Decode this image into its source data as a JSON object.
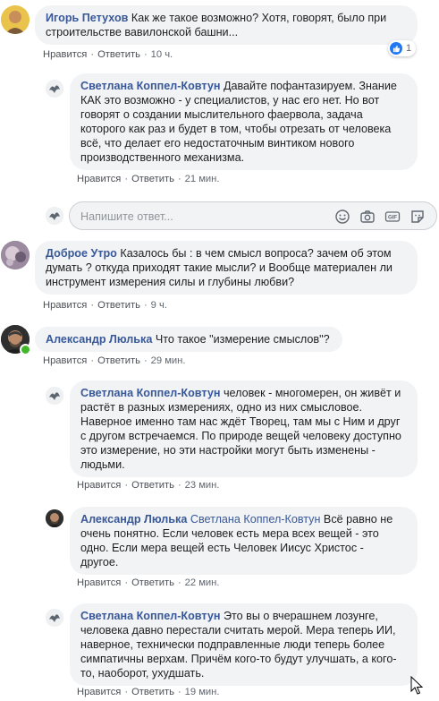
{
  "comments": [
    {
      "author": "Игорь Петухов",
      "text_lines": [
        "Как же такое возможно? Хотя, говорят, было при",
        "строительстве вавилонской башни..."
      ],
      "like": "Нравится",
      "reply": "Ответить",
      "time": "10 ч.",
      "reaction_count": "1"
    },
    {
      "author": "Светлана Коппел-Ковтун",
      "text_lines": [
        "Давайте пофантазируем. Знание",
        "КАК это возможно - у специалистов, у нас его нет. Но вот",
        "говорят о создании мыслительного фаервола, задача",
        "которого как раз и будет в том, чтобы отрезать от человека",
        "всё, что делает его недостаточным винтиком нового",
        "производственного механизма."
      ],
      "like": "Нравится",
      "reply": "Ответить",
      "time": "21 мин."
    },
    {
      "author": "Доброе Утро",
      "text_lines": [
        "Казалось бы : в чем смысл вопроса? зачем об этом",
        "думать ? откуда приходят такие мысли? и Вообще материален ли",
        "инструмент измерения силы и глубины любви?"
      ],
      "like": "Нравится",
      "reply": "Ответить",
      "time": "9 ч."
    },
    {
      "author": "Александр Люлька",
      "text_lines": [
        "Что такое \"измерение смыслов\"?"
      ],
      "like": "Нравится",
      "reply": "Ответить",
      "time": "29 мин."
    },
    {
      "author": "Светлана Коппел-Ковтун",
      "text_lines": [
        "человек - многомерен, он живёт и",
        "растёт в разных измерениях, одно из них смысловое.",
        "Наверное именно там нас ждёт Творец, там мы с Ним и друг",
        "с другом встречаемся. По природе вещей человеку доступно",
        "это измерение, но эти настройки могут быть изменены -",
        "людьми."
      ],
      "like": "Нравится",
      "reply": "Ответить",
      "time": "23 мин."
    },
    {
      "author": "Александр Люлька",
      "mention": "Светлана Коппел-Ковтун",
      "text_lines": [
        "Всё равно не",
        "очень понятно. Если человек есть мера всех вещей - это",
        "одно. Если мера вещей есть Человек Иисус Христос -",
        "другое."
      ],
      "like": "Нравится",
      "reply": "Ответить",
      "time": "22 мин."
    },
    {
      "author": "Светлана Коппел-Ковтун",
      "text_lines": [
        "Это вы о вчерашнем лозунге,",
        "человека давно перестали считать мерой. Мера теперь ИИ,",
        "наверное, технически подправленные люди теперь более",
        "симпатичны верхам. Причём кого-то будут улучшать, а кого-",
        "то, наоборот, ухудшать."
      ],
      "like": "Нравится",
      "reply": "Ответить",
      "time": "19 мин."
    }
  ],
  "reply_box": {
    "placeholder": "Напишите ответ..."
  },
  "icons": [
    "like-icon",
    "emoji-icon",
    "camera-icon",
    "gif-icon",
    "sticker-icon",
    "cursor-icon"
  ],
  "colors": {
    "author": "#385898",
    "bubble": "#f2f3f5",
    "like": "#2078f4",
    "online": "#42b72a"
  }
}
